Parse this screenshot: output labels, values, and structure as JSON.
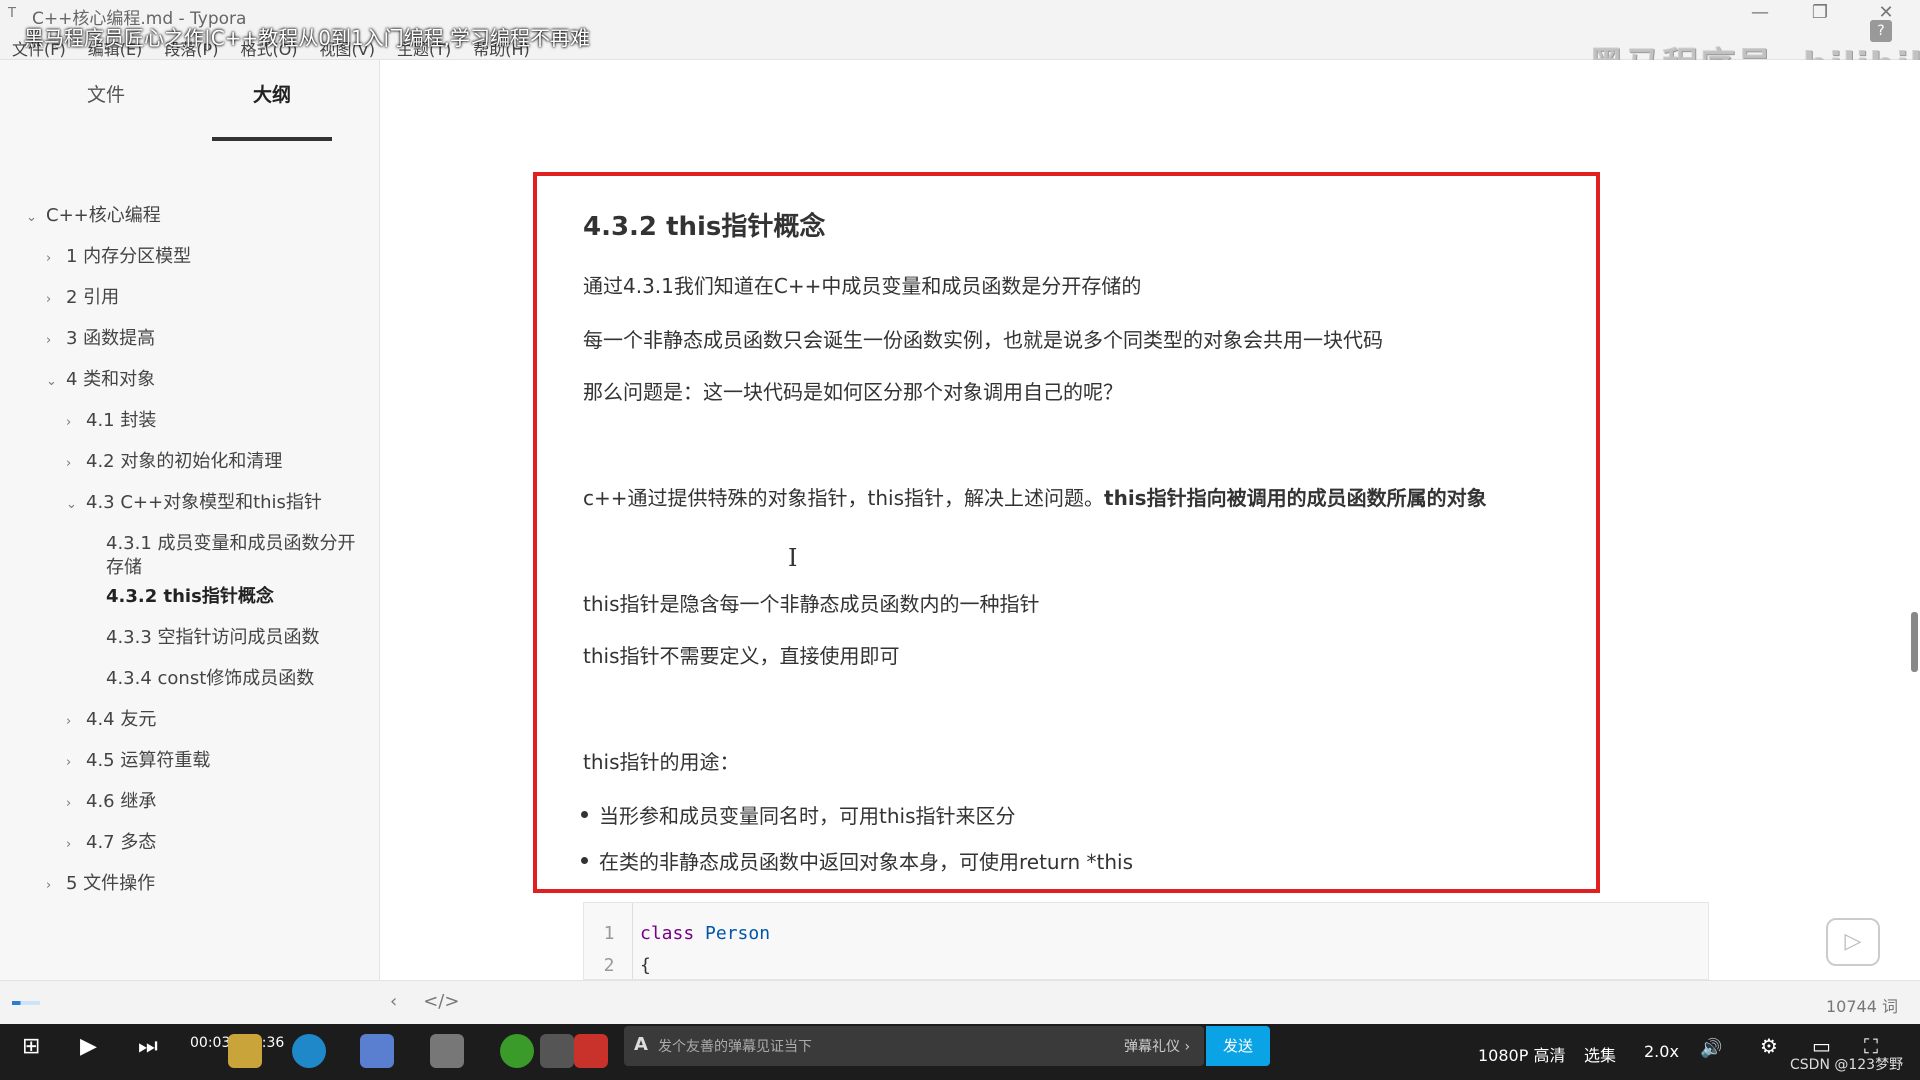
{
  "window": {
    "app_title": "C++核心编程.md - Typora",
    "video_title": "黑马程序员匠心之作|C++教程从0到1入门编程,学习编程不再难",
    "watermark": "黑马程序员- bilibili",
    "menu": [
      "文件(F)",
      "编辑(E)",
      "段落(P)",
      "格式(O)",
      "视图(V)",
      "主题(T)",
      "帮助(H)"
    ],
    "controls": {
      "minimize": "—",
      "maximize": "❐",
      "close": "✕"
    }
  },
  "sidebar": {
    "tabs": [
      "文件",
      "大纲"
    ],
    "active_tab": "大纲",
    "outline": [
      "C++核心编程",
      "1 内存分区模型",
      "2 引用",
      "3 函数提高",
      "4 类和对象",
      "4.1 封装",
      "4.2 对象的初始化和清理",
      "4.3 C++对象模型和this指针",
      "4.3.1 成员变量和成员函数分开存储",
      "4.3.2 this指针概念",
      "4.3.3 空指针访问成员函数",
      "4.3.4 const修饰成员函数",
      "4.4 友元",
      "4.5 运算符重载",
      "4.6 继承",
      "4.7 多态",
      "5 文件操作"
    ]
  },
  "document": {
    "heading": "4.3.2 this指针概念",
    "p1": "通过4.3.1我们知道在C++中成员变量和成员函数是分开存储的",
    "p2": "每一个非静态成员函数只会诞生一份函数实例，也就是说多个同类型的对象会共用一块代码",
    "p3": "那么问题是：这一块代码是如何区分那个对象调用自己的呢？",
    "p4_normal": "c++通过提供特殊的对象指针，this指针，解决上述问题。",
    "p4_bold": "this指针指向被调用的成员函数所属的对象",
    "p5": "this指针是隐含每一个非静态成员函数内的一种指针",
    "p6": "this指针不需要定义，直接使用即可",
    "p7": "this指针的用途：",
    "bullets": [
      "当形参和成员变量同名时，可用this指针来区分",
      "在类的非静态成员函数中返回对象本身，可使用return *this"
    ],
    "code": [
      {
        "ln": "1",
        "kw": "class",
        "rest": " Person"
      },
      {
        "ln": "2",
        "kw": "",
        "rest": "{"
      }
    ]
  },
  "statusbar": {
    "back": "‹",
    "source": "</>",
    "word_count": "10744 词"
  },
  "player": {
    "time": "00:03 / 15:36",
    "danmaku_placeholder": "发个友善的弹幕见证当下",
    "danmaku_gift": "弹幕礼仪 ›",
    "send": "发送",
    "quality": "1080P 高清",
    "episodes": "选集",
    "speed": "2.0x",
    "credit": "CSDN @123梦野"
  },
  "colors": {
    "highlight_border": "#e02020",
    "send_button": "#0aa3e6"
  }
}
